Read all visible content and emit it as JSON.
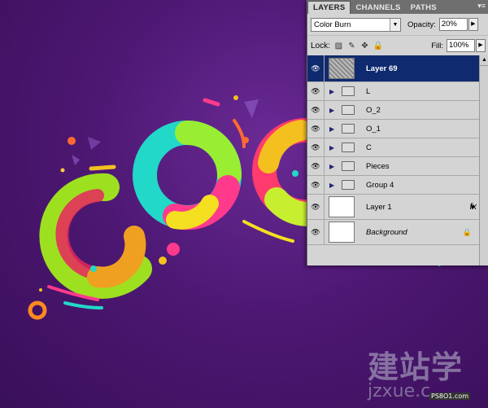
{
  "panel": {
    "tabs": [
      "LAYERS",
      "CHANNELS",
      "PATHS"
    ],
    "blend_mode": "Color Burn",
    "opacity_label": "Opacity:",
    "opacity_value": "20%",
    "lock_label": "Lock:",
    "fill_label": "Fill:",
    "fill_value": "100%"
  },
  "layers": [
    {
      "name": "Layer 69",
      "type": "layer",
      "selected": true
    },
    {
      "name": "L",
      "type": "group"
    },
    {
      "name": "O_2",
      "type": "group"
    },
    {
      "name": "O_1",
      "type": "group"
    },
    {
      "name": "C",
      "type": "group"
    },
    {
      "name": "Pieces",
      "type": "group"
    },
    {
      "name": "Group 4",
      "type": "group"
    },
    {
      "name": "Layer 1",
      "type": "layer",
      "fx": "fx"
    },
    {
      "name": "Background",
      "type": "layer",
      "locked": true
    }
  ],
  "watermark": {
    "main": "建站学",
    "sub": "jzxue.c",
    "small": "PS8O1.com"
  },
  "colors": {
    "panel_bg": "#d4d4d4",
    "selected": "#0f2a6e",
    "bg": "#4d1873"
  }
}
